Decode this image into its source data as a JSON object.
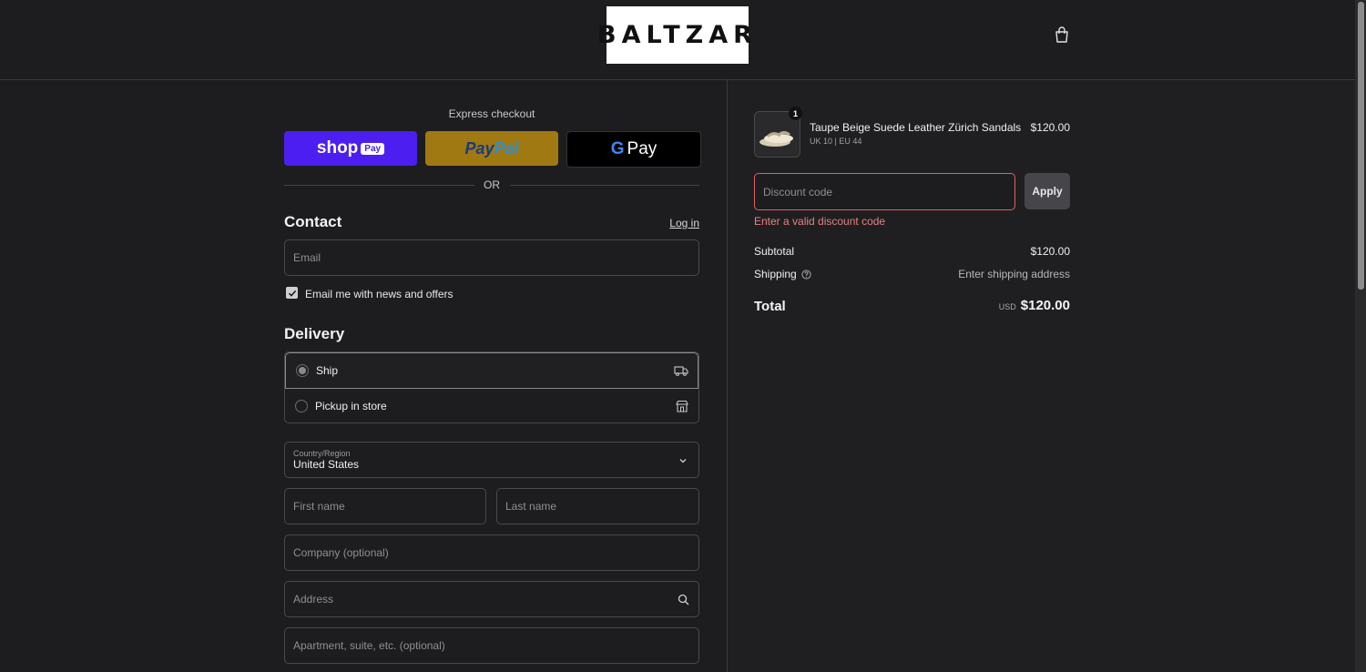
{
  "header": {
    "logo_text": "BALTZAR",
    "cart_icon": "shopping-bag-icon"
  },
  "express": {
    "title": "Express checkout",
    "shop_label": "shop",
    "shop_pay_badge": "Pay",
    "paypal_a": "Pay",
    "paypal_b": "Pal",
    "gpay_g": "G",
    "gpay_label": "Pay",
    "or_label": "OR"
  },
  "contact": {
    "heading": "Contact",
    "login_link": "Log in",
    "email_placeholder": "Email",
    "newsletter_label": "Email me with news and offers",
    "newsletter_checked": true
  },
  "delivery": {
    "heading": "Delivery",
    "options": [
      {
        "label": "Ship",
        "selected": true,
        "icon": "truck-icon"
      },
      {
        "label": "Pickup in store",
        "selected": false,
        "icon": "store-icon"
      }
    ],
    "country_label": "Country/Region",
    "country_value": "United States",
    "first_name_placeholder": "First name",
    "last_name_placeholder": "Last name",
    "company_placeholder": "Company (optional)",
    "address_placeholder": "Address",
    "apartment_placeholder": "Apartment, suite, etc. (optional)"
  },
  "summary": {
    "product": {
      "name": "Taupe Beige Suede Leather Zürich Sandals",
      "variant": "UK 10 | EU 44",
      "price": "$120.00",
      "quantity": "1"
    },
    "discount_placeholder": "Discount code",
    "apply_label": "Apply",
    "discount_error": "Enter a valid discount code",
    "subtotal_label": "Subtotal",
    "subtotal_value": "$120.00",
    "shipping_label": "Shipping",
    "shipping_value": "Enter shipping address",
    "total_label": "Total",
    "total_currency": "USD",
    "total_value": "$120.00"
  },
  "colors": {
    "background": "#1d1d1f",
    "shop_pay": "#4c1ff0",
    "paypal": "#a07912",
    "error": "#e06060"
  }
}
